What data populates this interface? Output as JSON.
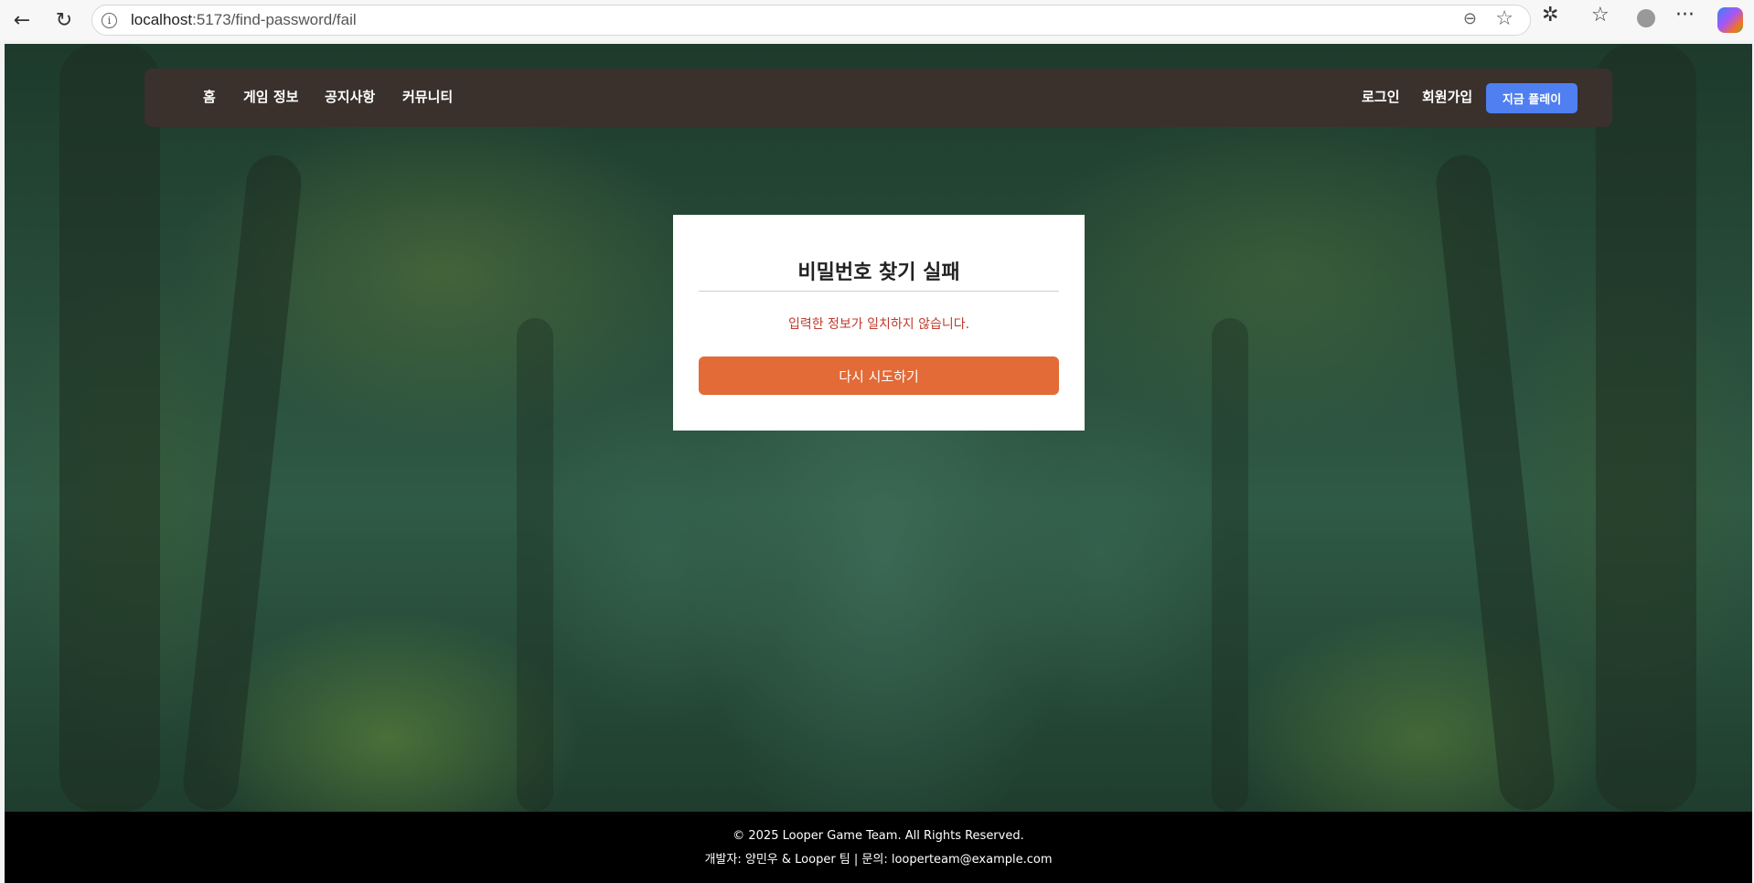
{
  "browser": {
    "back_icon": "←",
    "reload_icon": "↻",
    "url_host": "localhost",
    "url_path": ":5173/find-password/fail",
    "zoom_icon": "⊖",
    "star_icon": "☆",
    "extensions_icon": "✲",
    "favorites_icon": "☆",
    "more_icon": "···"
  },
  "nav": {
    "home": "홈",
    "game_info": "게임 정보",
    "notice": "공지사항",
    "community": "커뮤니티",
    "login": "로그인",
    "signup": "회원가입",
    "play_now": "지금 플레이"
  },
  "card": {
    "title": "비밀번호 찾기 실패",
    "error_message": "입력한 정보가 일치하지 않습니다.",
    "retry_label": "다시 시도하기"
  },
  "footer": {
    "copyright": "© 2025 Looper Game Team. All Rights Reserved.",
    "credits": "개발자: 양민우 & Looper 팀 | 문의: looperteam@example.com"
  },
  "colors": {
    "header_bg": "#3a312c",
    "play_button": "#4f7ff0",
    "retry_button": "#e26b38",
    "error_text": "#c0392b"
  }
}
